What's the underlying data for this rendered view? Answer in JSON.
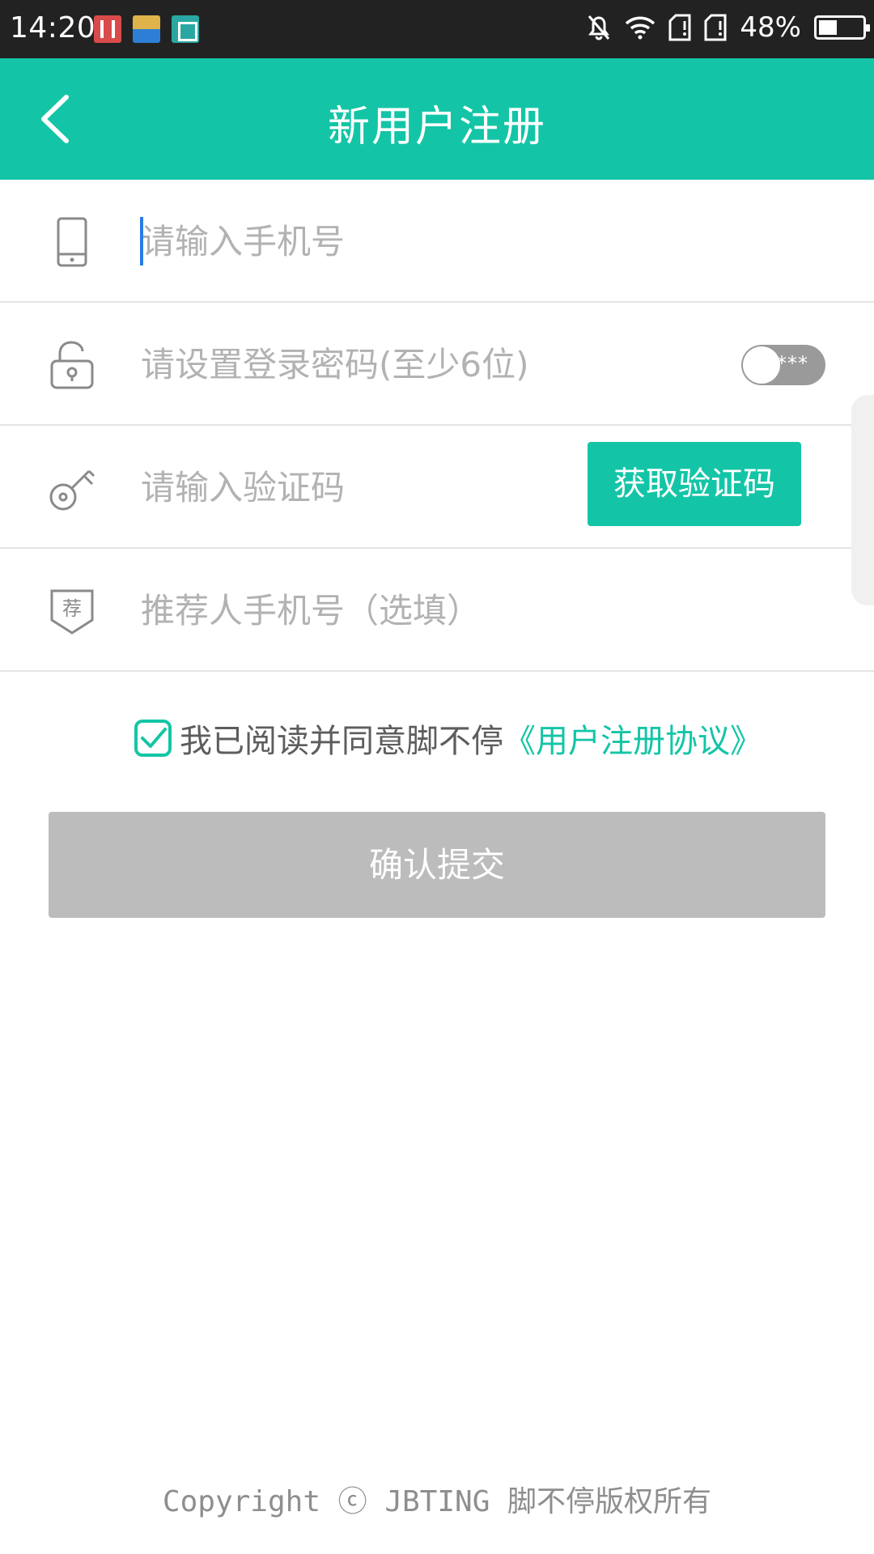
{
  "status_bar": {
    "time": "14:20",
    "battery": "48%",
    "battery_level": 0.48,
    "notification_icons": [
      "mail-app-icon",
      "gallery-app-icon",
      "scan-app-icon"
    ],
    "system_icons": [
      "mute-icon",
      "wifi-icon",
      "sim-card-icon",
      "sim-card-icon",
      "battery-icon"
    ]
  },
  "header": {
    "title": "新用户注册",
    "back_icon": "chevron-left-icon",
    "background": "#13c5a6"
  },
  "form": {
    "phone": {
      "icon": "phone-icon",
      "placeholder": "请输入手机号",
      "value": ""
    },
    "password": {
      "icon": "lock-icon",
      "placeholder": "请设置登录密码(至少6位)",
      "value": "",
      "toggle_label": "***",
      "toggle_on": false
    },
    "code": {
      "icon": "key-icon",
      "placeholder": "请输入验证码",
      "value": "",
      "button_label": "获取验证码"
    },
    "referrer": {
      "icon": "referrer-badge-icon",
      "badge_char": "荐",
      "placeholder": "推荐人手机号（选填）",
      "value": ""
    }
  },
  "agreement": {
    "checked": true,
    "text": "我已阅读并同意脚不停",
    "link": "《用户注册协议》"
  },
  "submit": {
    "label": "确认提交",
    "enabled": false
  },
  "footer": {
    "copyright": "Copyright ⓒ JBTING 脚不停版权所有"
  },
  "colors": {
    "accent": "#13c5a6",
    "placeholder": "#b2b2b2",
    "disabled_button": "#bcbcbc",
    "status_bar": "#222222"
  }
}
